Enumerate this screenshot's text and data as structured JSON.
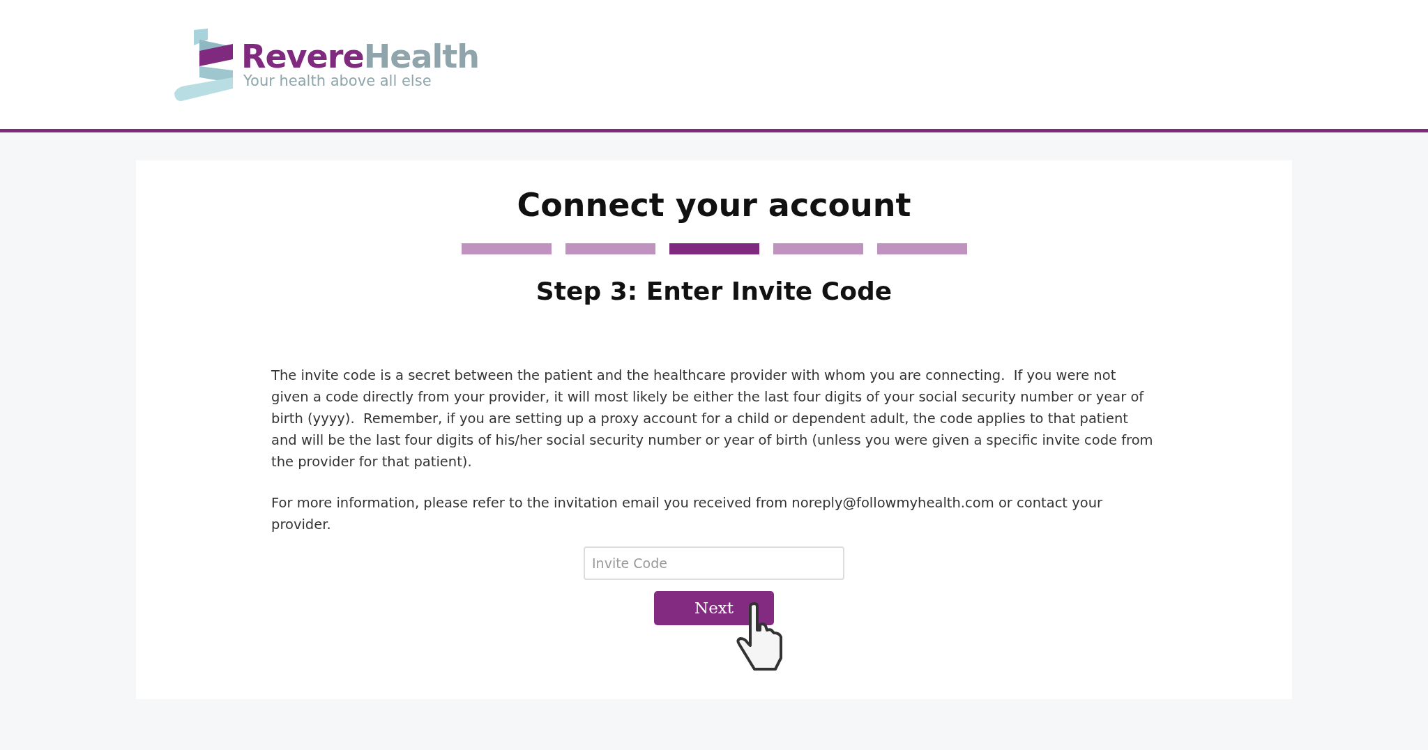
{
  "logo": {
    "name_part_1": "Revere",
    "name_part_2": "Health",
    "tagline": "Your health above all else"
  },
  "title": "Connect your account",
  "steps": [
    {
      "selected": false
    },
    {
      "selected": false
    },
    {
      "selected": true
    },
    {
      "selected": false
    },
    {
      "selected": false
    }
  ],
  "step_title": "Step 3: Enter Invite Code",
  "paragraphs": [
    "The invite code is a secret between the patient and the healthcare provider with whom you are connecting.  If you were not given a code directly from your provider, it will most likely be either the last four digits of your social security number or year of birth (yyyy).  Remember, if you are setting up a proxy account for a child or dependent adult, the code applies to that patient and will be the last four digits of his/her social security number or year of birth (unless you were given a specific invite code from the provider for that patient).",
    "For more information, please refer to the invitation email you received from noreply@followmyhealth.com or contact your provider."
  ],
  "invite_code": {
    "placeholder": "Invite Code"
  },
  "next_button": "Next"
}
